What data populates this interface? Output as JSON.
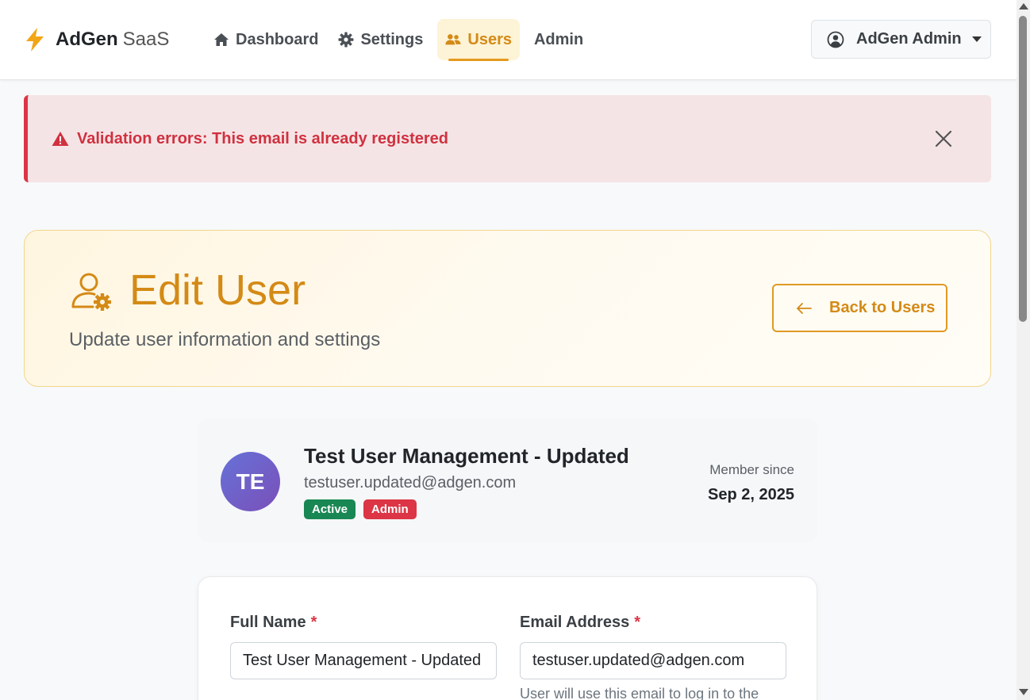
{
  "brand": {
    "name": "AdGen",
    "suffix": "SaaS"
  },
  "nav": {
    "items": [
      {
        "label": "Dashboard",
        "icon": "home-icon"
      },
      {
        "label": "Settings",
        "icon": "gear-icon"
      },
      {
        "label": "Users",
        "icon": "users-icon",
        "active": true
      },
      {
        "label": "Admin"
      }
    ]
  },
  "user_menu": {
    "label": "AdGen Admin"
  },
  "alert": {
    "message": "Validation errors: This email is already registered"
  },
  "header": {
    "title": "Edit User",
    "subtitle": "Update user information and settings",
    "back_label": "Back to Users"
  },
  "profile": {
    "initials": "TE",
    "name": "Test User Management - Updated",
    "email": "testuser.updated@adgen.com",
    "badges": [
      "Active",
      "Admin"
    ],
    "member_since_label": "Member since",
    "member_since_date": "Sep 2, 2025"
  },
  "form": {
    "full_name_label": "Full Name",
    "full_name_value": "Test User Management - Updated",
    "email_label": "Email Address",
    "email_value": "testuser.updated@adgen.com",
    "email_help": "User will use this email to log in to the",
    "required_mark": "*"
  },
  "colors": {
    "accent": "#d48a16",
    "danger": "#dc3545",
    "success": "#198754",
    "alert_bg": "#f5e4e6"
  }
}
